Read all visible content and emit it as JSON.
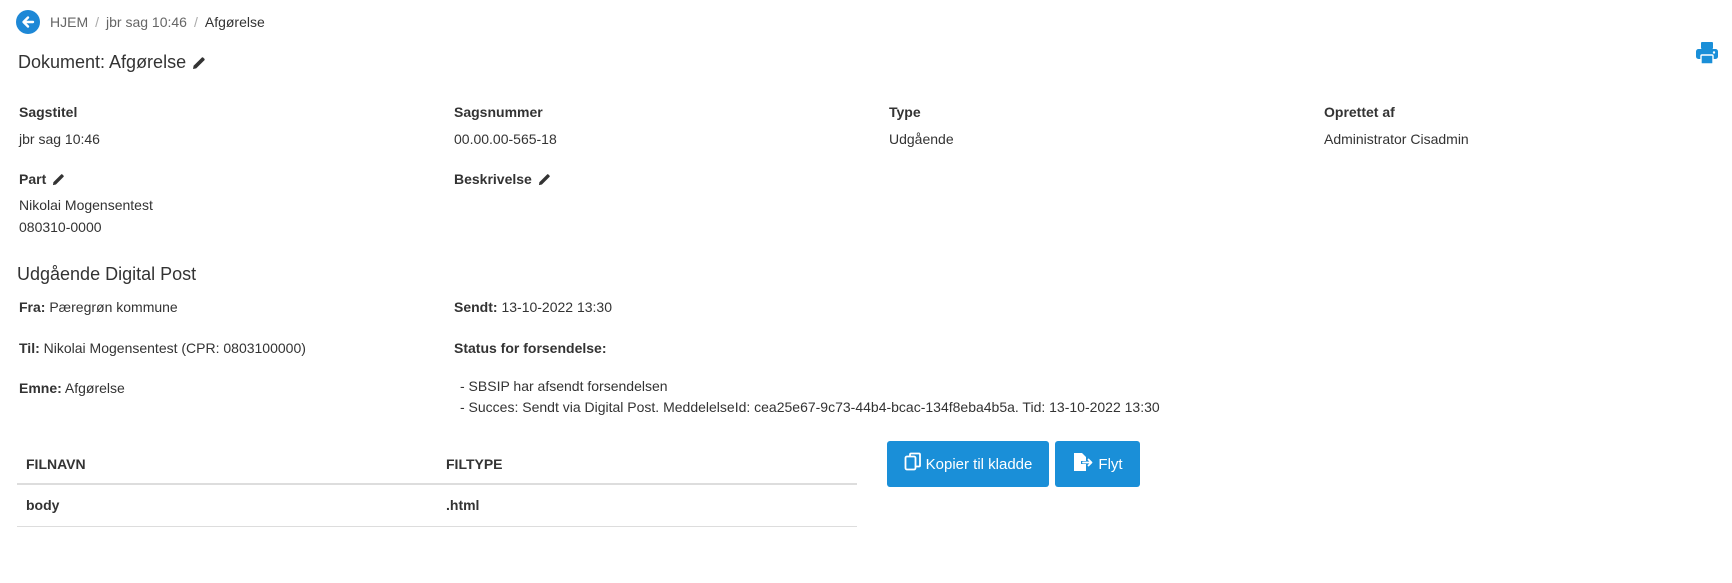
{
  "breadcrumb": {
    "items": [
      {
        "label": "HJEM"
      },
      {
        "label": "jbr sag 10:46"
      },
      {
        "label": "Afgørelse"
      }
    ],
    "separator": "/"
  },
  "document": {
    "title": "Dokument: Afgørelse"
  },
  "fields": {
    "sagstitel": {
      "label": "Sagstitel",
      "value": "jbr sag 10:46"
    },
    "sagsnummer": {
      "label": "Sagsnummer",
      "value": "00.00.00-565-18"
    },
    "type": {
      "label": "Type",
      "value": "Udgående"
    },
    "oprettet_af": {
      "label": "Oprettet af",
      "value": "Administrator Cisadmin"
    },
    "part": {
      "label": "Part",
      "name": "Nikolai Mogensentest",
      "cpr": "080310-0000"
    },
    "beskrivelse": {
      "label": "Beskrivelse"
    }
  },
  "digital_post": {
    "title": "Udgående Digital Post",
    "fra_label": "Fra:",
    "fra_value": "Pæregrøn kommune",
    "sendt_label": "Sendt:",
    "sendt_value": "13-10-2022 13:30",
    "til_label": "Til:",
    "til_value": "Nikolai Mogensentest (CPR: 0803100000)",
    "status_label": "Status for forsendelse:",
    "emne_label": "Emne:",
    "emne_value": "Afgørelse",
    "status_lines": [
      "- SBSIP har afsendt forsendelsen",
      "- Succes: Sendt via Digital Post. MeddelelseId: cea25e67-9c73-44b4-bcac-134f8eba4b5a. Tid: 13-10-2022 13:30"
    ]
  },
  "files": {
    "headers": [
      "FILNAVN",
      "FILTYPE"
    ],
    "rows": [
      {
        "name": "body",
        "type": ".html"
      }
    ]
  },
  "actions": {
    "copy_label": "Kopier til kladde",
    "move_label": "Flyt"
  },
  "colors": {
    "accent": "#1a8fd8",
    "text": "#333333"
  }
}
